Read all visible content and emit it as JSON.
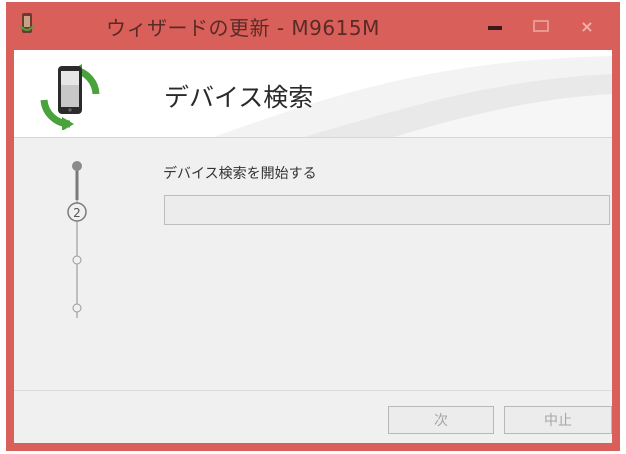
{
  "window": {
    "title": "ウィザードの更新 - M9615M",
    "controls": {
      "minimize": "minimize",
      "maximize": "maximize",
      "close": "×"
    }
  },
  "header": {
    "title": "デバイス検索",
    "icon": "phone-sync-icon"
  },
  "wizard": {
    "current_step_number": "2",
    "step_description": "デバイス検索を開始する",
    "progress": 0
  },
  "buttons": {
    "next_label": "次",
    "cancel_label": "中止"
  },
  "colors": {
    "frame": "#d9605a",
    "client_bg": "#f0f0f0",
    "header_bg": "#ffffff",
    "arrow_green": "#4aa23a"
  }
}
